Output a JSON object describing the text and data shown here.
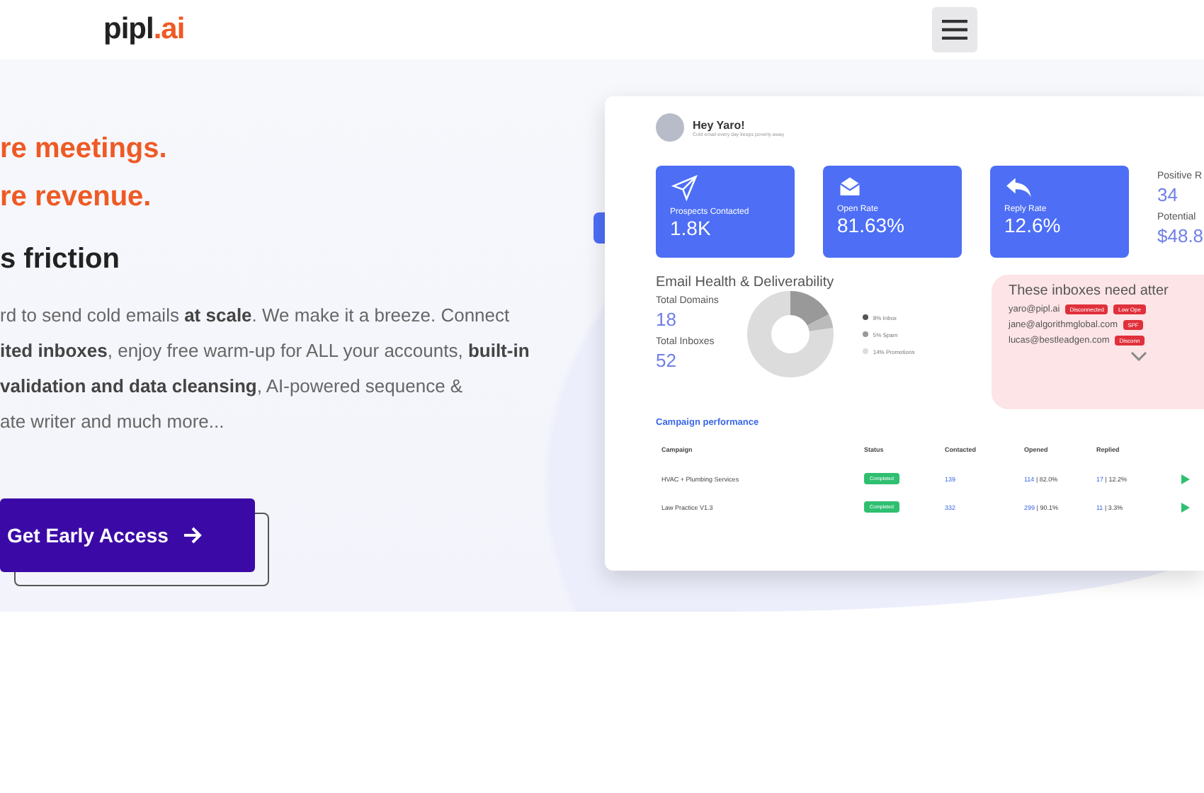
{
  "header": {
    "logo": {
      "name": "pipl",
      "suffix": ".ai"
    }
  },
  "hero": {
    "headlines": [
      {
        "text": "re meetings.",
        "kind": "accent"
      },
      {
        "text": "re revenue.",
        "kind": "accent"
      },
      {
        "text": "s friction",
        "kind": "plain"
      }
    ],
    "paragraph_lines": [
      "rd to send cold emails **at scale**. We make it a breeze. Connect",
      "**ited inboxes**, enjoy free warm-up for ALL your accounts, **built-in**",
      "**validation and data cleansing**, AI-powered sequence &",
      "ate writer and much more..."
    ],
    "cta": "Get Early Access"
  },
  "dashboard": {
    "greeting": "Hey Yaro!",
    "tagline": "Cold email every day keeps poverty away",
    "stats": [
      {
        "label": "Prospects Contacted",
        "value": "1.8K",
        "kind": "plane"
      },
      {
        "label": "Open Rate",
        "value": "81.63%",
        "kind": "envelope"
      },
      {
        "label": "Reply Rate",
        "value": "12.6%",
        "kind": "reply"
      }
    ],
    "side_stats": [
      {
        "label": "Positive R",
        "value": "34"
      },
      {
        "label": "Potential",
        "value": "$48.8"
      }
    ],
    "health": {
      "title": "Email Health & Deliverability",
      "metrics": [
        {
          "label": "Total Domains",
          "value": "18"
        },
        {
          "label": "Total Inboxes",
          "value": "52"
        }
      ],
      "legend": [
        "8% Inbox",
        "5% Spam",
        "14% Promotions"
      ]
    },
    "alerts": {
      "title": "These inboxes need atter",
      "rows": [
        {
          "email": "yaro@pipl.ai",
          "tags": [
            "Disconnected",
            "Low Ope"
          ]
        },
        {
          "email": "jane@algorithmglobal.com",
          "tags": [
            "SPF"
          ]
        },
        {
          "email": "lucas@bestleadgen.com",
          "tags": [
            "Disconn"
          ]
        }
      ]
    },
    "campaigns": {
      "title": "Campaign performance",
      "columns": [
        "Campaign",
        "Status",
        "Contacted",
        "Opened",
        "Replied"
      ],
      "rows": [
        {
          "name": "HVAC + Plumbing Services",
          "status": "Completed",
          "contacted": "139",
          "opened": "114",
          "opened_pct": "| 82.0%",
          "replied": "17",
          "replied_pct": "| 12.2%"
        },
        {
          "name": "Law Practice V1.3",
          "status": "Completed",
          "contacted": "332",
          "opened": "299",
          "opened_pct": "| 90.1%",
          "replied": "11",
          "replied_pct": "| 3.3%"
        }
      ]
    }
  }
}
